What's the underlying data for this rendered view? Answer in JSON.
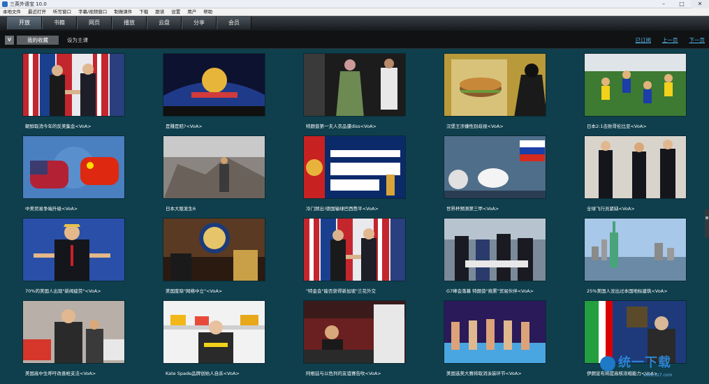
{
  "window": {
    "title": "三英外语宝 10.0"
  },
  "menu": [
    "本地文件",
    "最近打开",
    "听写窗口",
    "字幕/视频窗口",
    "制做课件",
    "下载",
    "跟读",
    "设置",
    "用户",
    "帮助"
  ],
  "nav": {
    "tabs": [
      "开放",
      "书籍",
      "网页",
      "播放",
      "云盘",
      "分享",
      "会员"
    ],
    "active_index": 0
  },
  "subbar": {
    "badge": "V",
    "favorites_label": "我的收藏",
    "set_home_label": "设为主课",
    "pager": [
      "已订阅",
      "上一页",
      "下一页"
    ]
  },
  "items": [
    {
      "caption": "朝鲜取消今年的反美集会<VoA>",
      "scene": "flags-handshake"
    },
    {
      "caption": "是赚是赔?<VoA>",
      "scene": "stadium-night"
    },
    {
      "caption": "特朗普第一夫人衣品遭diss<VoA>",
      "scene": "jacket"
    },
    {
      "caption": "汉堡王涉嫌性别歧视<VoA>",
      "scene": "burger"
    },
    {
      "caption": "日本2:1击败哥伦比亚<VoA>",
      "scene": "soccer"
    },
    {
      "caption": "中美贸易争端升级<VoA>",
      "scene": "trade-fists"
    },
    {
      "caption": "日本大阪发生6",
      "scene": "rubble"
    },
    {
      "caption": "冷门频出!德国输球巴西憋平<VoA>",
      "scene": "russia2018"
    },
    {
      "caption": "世界杯预测第三甲<VoA>",
      "scene": "cat-flag"
    },
    {
      "caption": "全球飞行员紧缺<VoA>",
      "scene": "pilots"
    },
    {
      "caption": "70%的美国人出现\"新闻疲劳\"<VoA>",
      "scene": "speaker-blue"
    },
    {
      "caption": "美国废除\"网络中立\"<VoA>",
      "scene": "commission"
    },
    {
      "caption": "\"特金会\"能否获得新加坡\"兰花外交",
      "scene": "flags-handshake"
    },
    {
      "caption": "G7峰会落幕 特朗普\"拖累\"贸易伙伴<VoA>",
      "scene": "g7"
    },
    {
      "caption": "25%美国人没出过本国地标建筑<VoA>",
      "scene": "liberty"
    },
    {
      "caption": "美国高中生呼吁改善枪支法<VoA>",
      "scene": "protest"
    },
    {
      "caption": "Kate Spade品牌创始人自杀<VoA>",
      "scene": "kate"
    },
    {
      "caption": "阿根廷与以色列的友谊赛告吹<VoA>",
      "scene": "press"
    },
    {
      "caption": "美国选美大赛将取消泳装环节<VoA>",
      "scene": "pageant"
    },
    {
      "caption": "伊朗宣布将提高核浓缩能力<VoA>",
      "scene": "iran"
    }
  ],
  "watermark": {
    "text": "统一下载",
    "url": "www.xz7.com"
  },
  "colors": {
    "background": "#0f3f4d",
    "link": "#55b8ea",
    "nav_active": "#5f6e7a"
  }
}
